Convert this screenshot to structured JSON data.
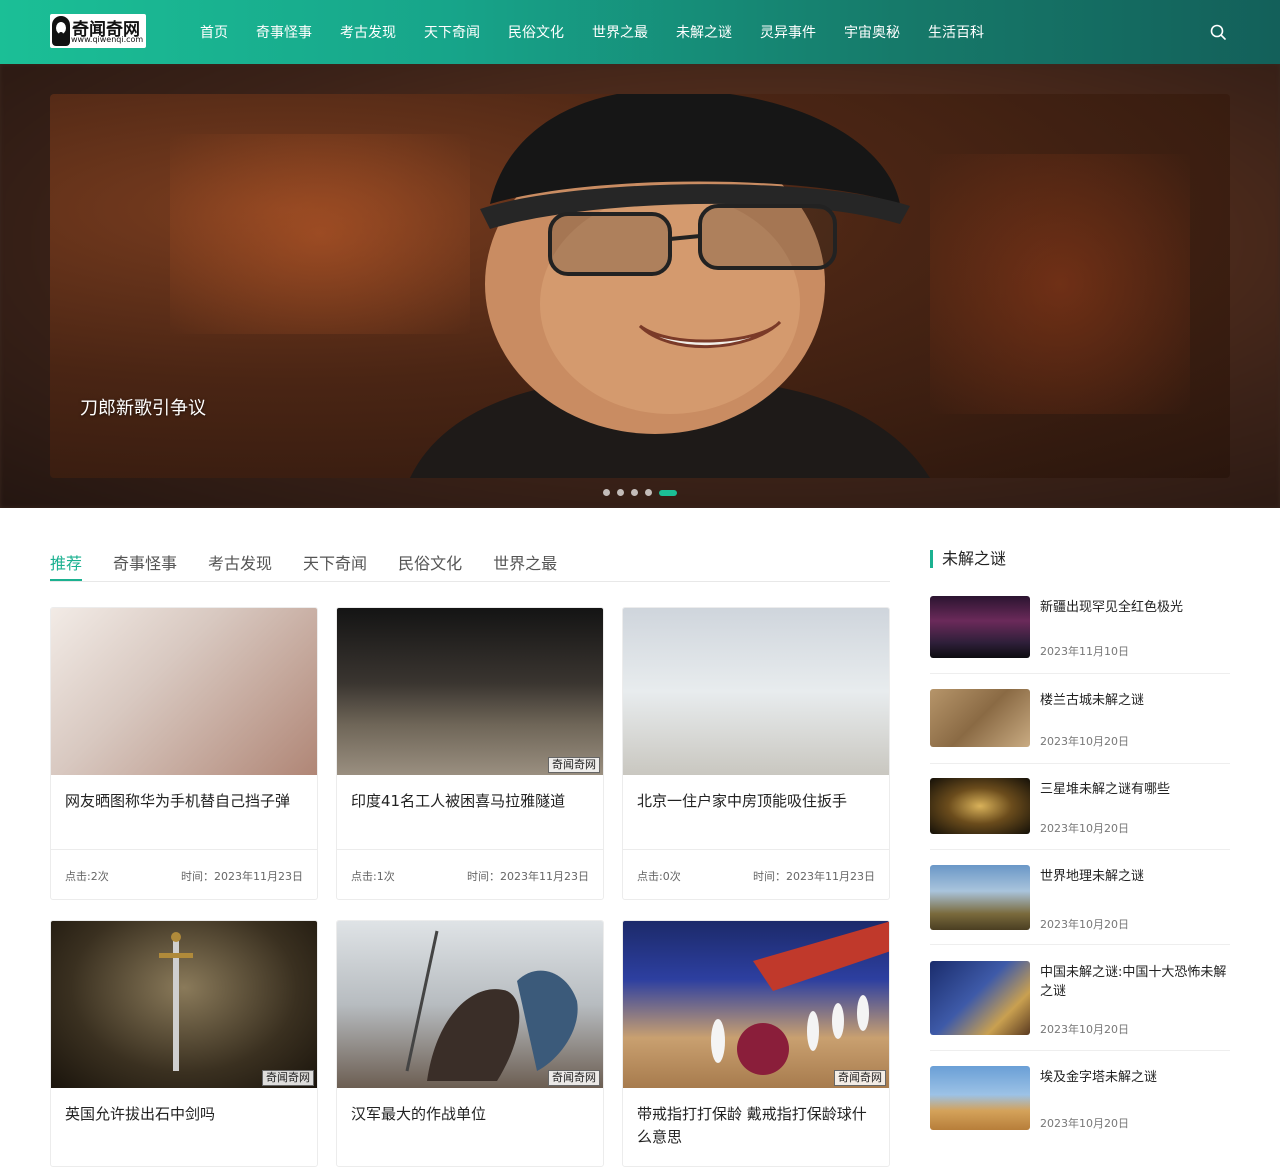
{
  "header": {
    "logo_text": "奇闻奇网",
    "logo_sub": "www.qiwenqi.com",
    "nav": [
      "首页",
      "奇事怪事",
      "考古发现",
      "天下奇闻",
      "民俗文化",
      "世界之最",
      "未解之谜",
      "灵异事件",
      "宇宙奥秘",
      "生活百科"
    ],
    "search_icon": "search-icon"
  },
  "hero": {
    "caption": "刀郎新歌引争议",
    "slide_count": 5,
    "active_slide": 5
  },
  "tabs": [
    "推荐",
    "奇事怪事",
    "考古发现",
    "天下奇闻",
    "民俗文化",
    "世界之最"
  ],
  "watermark": "奇闻奇网",
  "cards": [
    {
      "title": "网友晒图称华为手机替自己挡子弹",
      "hits": "点击:2次",
      "time": "时间：2023年11月23日"
    },
    {
      "title": "印度41名工人被困喜马拉雅隧道",
      "hits": "点击:1次",
      "time": "时间：2023年11月23日"
    },
    {
      "title": "北京一住户家中房顶能吸住扳手",
      "hits": "点击:0次",
      "time": "时间：2023年11月23日"
    },
    {
      "title": "英国允许拔出石中剑吗",
      "hits": "",
      "time": ""
    },
    {
      "title": "汉军最大的作战单位",
      "hits": "",
      "time": ""
    },
    {
      "title": "带戒指打打保龄 戴戒指打保龄球什么意思",
      "hits": "",
      "time": ""
    }
  ],
  "sidebar": {
    "title": "未解之谜",
    "items": [
      {
        "title": "新疆出现罕见全红色极光",
        "date": "2023年11月10日"
      },
      {
        "title": "楼兰古城未解之谜",
        "date": "2023年10月20日"
      },
      {
        "title": "三星堆未解之谜有哪些",
        "date": "2023年10月20日"
      },
      {
        "title": "世界地理未解之谜",
        "date": "2023年10月20日"
      },
      {
        "title": "中国未解之谜:中国十大恐怖未解之谜",
        "date": "2023年10月20日"
      },
      {
        "title": "埃及金字塔未解之谜",
        "date": "2023年10月20日"
      }
    ]
  }
}
